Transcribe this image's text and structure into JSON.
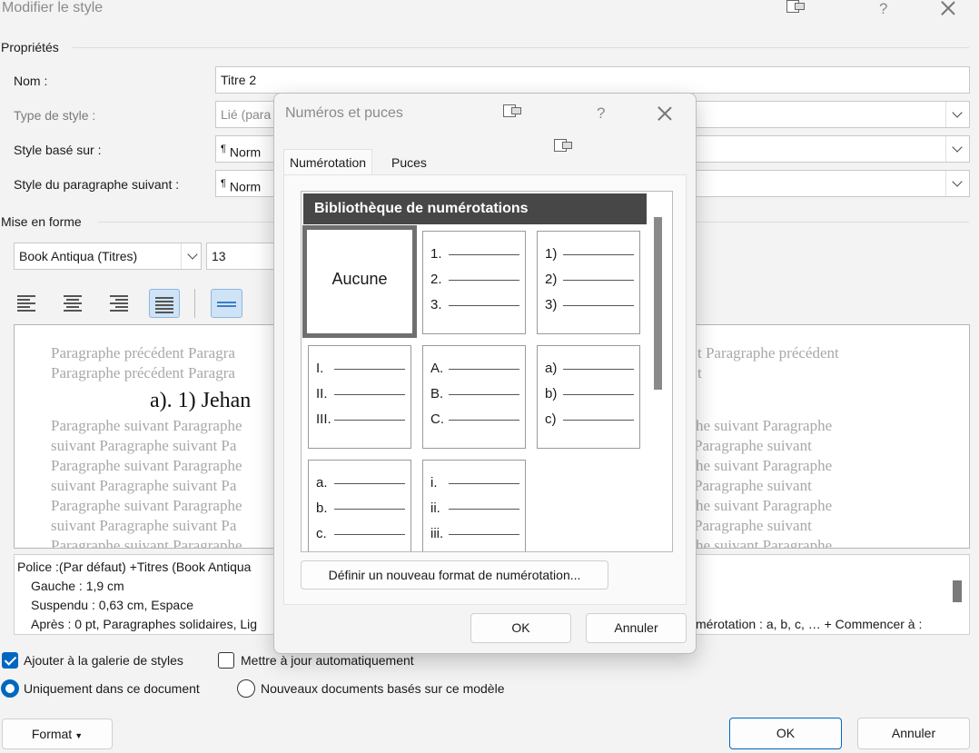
{
  "window": {
    "title": "Modifier le style",
    "help": "?"
  },
  "properties": {
    "section_label": "Propriétés",
    "name_label": "Nom :",
    "name_value": "Titre 2",
    "type_label": "Type de style :",
    "type_value": "Lié (para",
    "based_on_label": "Style basé sur :",
    "based_on_value": "Norm",
    "next_label": "Style du paragraphe suivant :",
    "next_value": "Norm",
    "pilcrow": "¶"
  },
  "formatting": {
    "section_label": "Mise en forme",
    "font_value": "Book Antiqua (Titres)",
    "size_value": "13"
  },
  "preview": {
    "prev_left": [
      "Paragraphe précédent Paragra",
      "Paragraphe précédent Paragra"
    ],
    "prev_right": [
      "t Paragraphe précédent",
      "t"
    ],
    "heading": "a). 1) Jehan",
    "next_left": [
      "Paragraphe suivant Paragraphe",
      "suivant Paragraphe suivant Pa",
      "Paragraphe suivant Paragraphe",
      "suivant Paragraphe suivant Pa",
      "Paragraphe suivant Paragraphe",
      "suivant Paragraphe suivant Pa",
      "Paragraphe suivant Paragraphe"
    ],
    "next_right": [
      "he suivant Paragraphe",
      "Paragraphe suivant",
      "he suivant Paragraphe",
      "Paragraphe suivant",
      "he suivant Paragraphe",
      "Paragraphe suivant",
      "he suivant Paragraphe"
    ]
  },
  "description": {
    "line1": "Police :(Par défaut) +Titres (Book Antiqua",
    "line2": "Gauche :  1,9 cm",
    "line3": "Suspendu : 0,63 cm, Espace",
    "line4": "Après : 0 pt, Paragraphes solidaires, Lig",
    "line4_right": "mérotation : a, b, c, … + Commencer à :"
  },
  "options": {
    "add_gallery": "Ajouter à la galerie de styles",
    "auto_update": "Mettre à jour automatiquement",
    "only_doc": "Uniquement dans ce document",
    "new_docs": "Nouveaux documents basés sur ce modèle"
  },
  "buttons": {
    "format": "Format",
    "ok": "OK",
    "cancel": "Annuler"
  },
  "modal": {
    "title": "Numéros et puces",
    "help": "?",
    "tabs": [
      "Numérotation",
      "Puces"
    ],
    "gallery_title": "Bibliothèque de numérotations",
    "none_label": "Aucune",
    "cells": [
      [
        "1.",
        "2.",
        "3."
      ],
      [
        "1)",
        "2)",
        "3)"
      ],
      [
        "I.",
        "II.",
        "III."
      ],
      [
        "A.",
        "B.",
        "C."
      ],
      [
        "a)",
        "b)",
        "c)"
      ],
      [
        "a.",
        "b.",
        "c."
      ],
      [
        "i.",
        "ii.",
        "iii."
      ]
    ],
    "define_button": "Définir un nouveau format de numérotation...",
    "ok": "OK",
    "cancel": "Annuler"
  }
}
